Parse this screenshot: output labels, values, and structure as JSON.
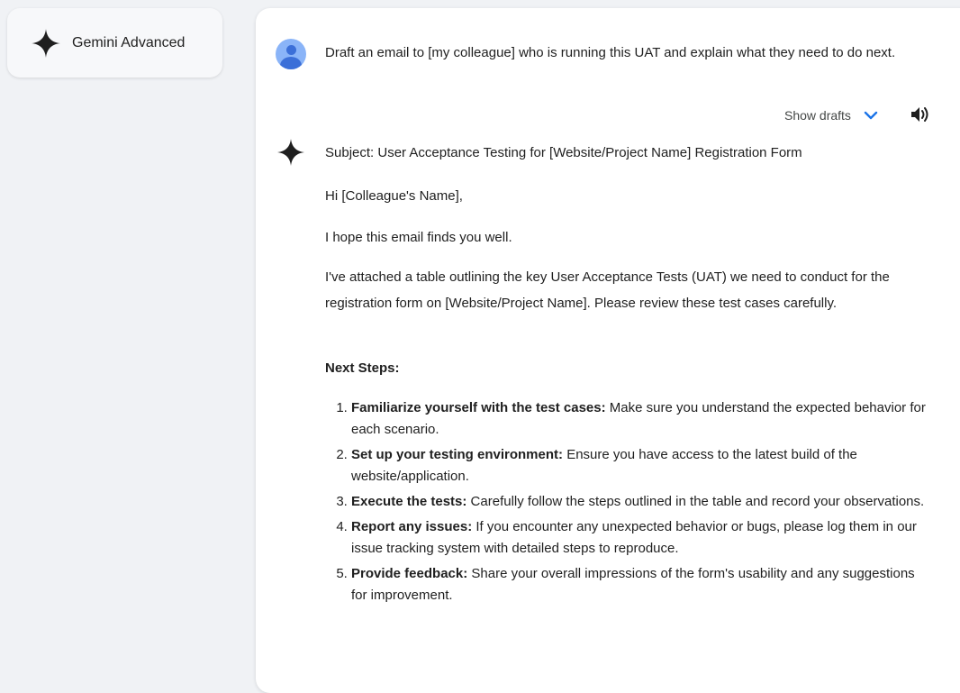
{
  "sidebar": {
    "model_label": "Gemini Advanced",
    "model_icon": "gemini-sparkle-icon"
  },
  "conversation": {
    "user_prompt": "Draft an email to [my colleague] who is running this UAT and explain what they need to do next.",
    "show_drafts_label": "Show drafts",
    "response": {
      "subject": "Subject: User Acceptance Testing for [Website/Project Name] Registration Form",
      "greeting": "Hi [Colleague's Name],",
      "opening": "I hope this email finds you well.",
      "body": "I've attached a table outlining the key User Acceptance Tests (UAT) we need to conduct for the registration form on [Website/Project Name]. Please review these test cases carefully.",
      "next_steps_heading": "Next Steps:",
      "steps": [
        {
          "title": "Familiarize yourself with the test cases:",
          "text": " Make sure you understand the expected behavior for each scenario."
        },
        {
          "title": "Set up your testing environment:",
          "text": " Ensure you have access to the latest build of the website/application."
        },
        {
          "title": "Execute the tests:",
          "text": " Carefully follow the steps outlined in the table and record your observations."
        },
        {
          "title": "Report any issues:",
          "text": " If you encounter any unexpected behavior or bugs, please log them in our issue tracking system with detailed steps to reproduce."
        },
        {
          "title": "Provide feedback:",
          "text": " Share your overall impressions of the form's usability and any suggestions for improvement."
        }
      ]
    }
  },
  "colors": {
    "accent": "#1a73e8",
    "avatar": "#8ab4f8",
    "background": "#f0f2f5"
  }
}
